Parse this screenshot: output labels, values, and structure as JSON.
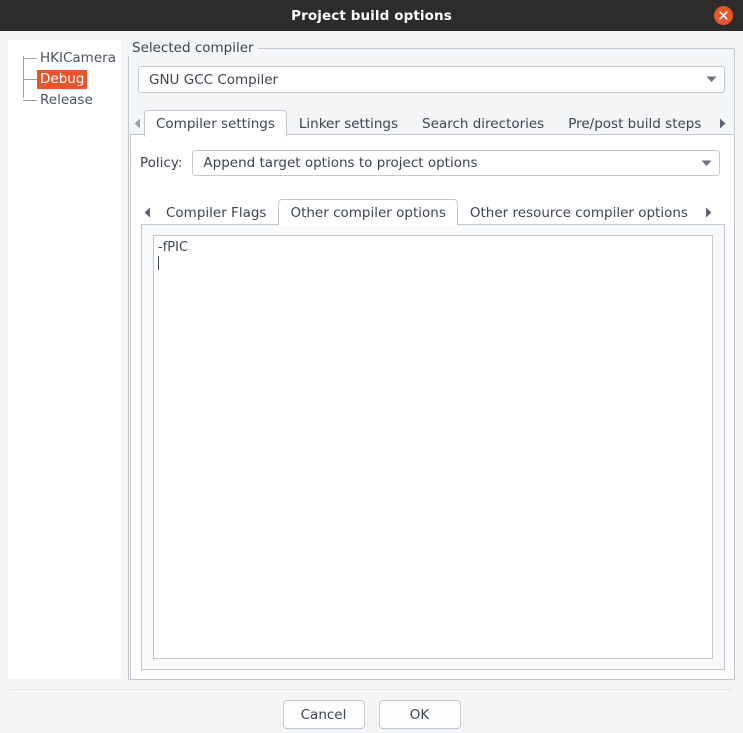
{
  "window": {
    "title": "Project build options",
    "close_icon": "close-icon"
  },
  "sidebar": {
    "tree": [
      {
        "label": "HKICamera",
        "selected": false
      },
      {
        "label": "Debug",
        "selected": true
      },
      {
        "label": "Release",
        "selected": false
      }
    ]
  },
  "compiler_group": {
    "legend": "Selected compiler",
    "selected_compiler": "GNU GCC Compiler",
    "dropdown_icon": "chevron-down-icon"
  },
  "outer_tabs": {
    "scroll_left_icon": "chevron-left-icon",
    "scroll_right_icon": "chevron-right-icon",
    "items": [
      {
        "label": "Compiler settings",
        "active": true
      },
      {
        "label": "Linker settings",
        "active": false
      },
      {
        "label": "Search directories",
        "active": false
      },
      {
        "label": "Pre/post build steps",
        "active": false
      }
    ]
  },
  "policy": {
    "label": "Policy:",
    "value": "Append target options to project options",
    "dropdown_icon": "chevron-down-icon"
  },
  "inner_tabs": {
    "scroll_left_icon": "chevron-left-icon",
    "scroll_right_icon": "chevron-right-icon",
    "items": [
      {
        "label": "Compiler Flags",
        "active": false
      },
      {
        "label": "Other compiler options",
        "active": true
      },
      {
        "label": "Other resource compiler options",
        "active": false
      }
    ]
  },
  "editor": {
    "line1": "-fPIC",
    "line2": ""
  },
  "footer": {
    "cancel_label": "Cancel",
    "ok_label": "OK"
  },
  "colors": {
    "titlebar_bg": "#2e2c2b",
    "accent": "#e8552a",
    "page_bg": "#f4f5f7",
    "border": "#c3c8cf",
    "text": "#3c4450"
  }
}
